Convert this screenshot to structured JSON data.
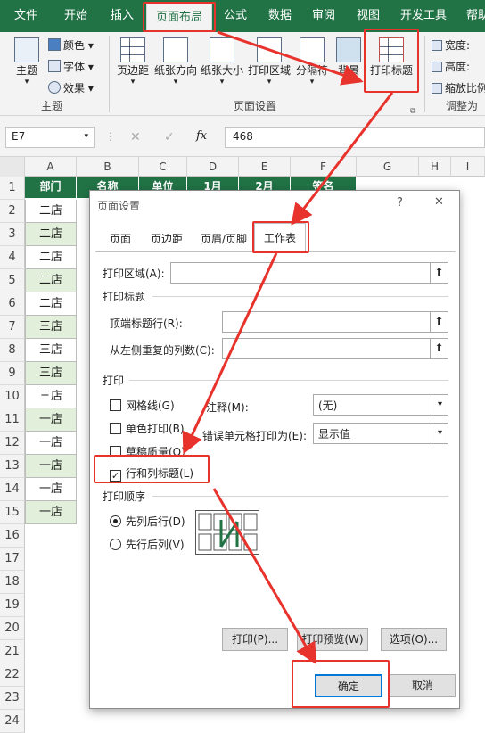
{
  "ribbon_tabs": [
    "文件",
    "开始",
    "插入",
    "页面布局",
    "公式",
    "数据",
    "审阅",
    "视图",
    "开发工具",
    "帮助"
  ],
  "ribbon": {
    "theme": {
      "main": "主题",
      "colors": "颜色",
      "fonts": "字体",
      "effects": "效果",
      "group": "主题"
    },
    "page_setup": {
      "margins": "页边距",
      "orientation": "纸张方向",
      "size": "纸张大小",
      "print_area": "打印区域",
      "breaks": "分隔符",
      "background": "背景",
      "print_titles": "打印标题",
      "group": "页面设置"
    },
    "scale": {
      "width": "宽度:",
      "height": "高度:",
      "scale": "缩放比例",
      "group": "调整为合"
    }
  },
  "formula_bar": {
    "name_box": "E7",
    "value": "468",
    "fx": "fx"
  },
  "columns": [
    "A",
    "B",
    "C",
    "D",
    "E",
    "F",
    "G",
    "H",
    "I"
  ],
  "header_row": [
    "部门",
    "名称",
    "单位",
    "1月",
    "2月",
    "签名"
  ],
  "rows": [
    {
      "n": "1",
      "a": "部门"
    },
    {
      "n": "2",
      "a": "二店"
    },
    {
      "n": "3",
      "a": "二店"
    },
    {
      "n": "4",
      "a": "二店"
    },
    {
      "n": "5",
      "a": "二店"
    },
    {
      "n": "6",
      "a": "二店"
    },
    {
      "n": "7",
      "a": "三店"
    },
    {
      "n": "8",
      "a": "三店"
    },
    {
      "n": "9",
      "a": "三店"
    },
    {
      "n": "10",
      "a": "三店"
    },
    {
      "n": "11",
      "a": "一店"
    },
    {
      "n": "12",
      "a": "一店"
    },
    {
      "n": "13",
      "a": "一店"
    },
    {
      "n": "14",
      "a": "一店"
    },
    {
      "n": "15",
      "a": "一店"
    },
    {
      "n": "16",
      "a": ""
    },
    {
      "n": "17",
      "a": ""
    },
    {
      "n": "18",
      "a": ""
    },
    {
      "n": "19",
      "a": ""
    },
    {
      "n": "20",
      "a": ""
    },
    {
      "n": "21",
      "a": ""
    },
    {
      "n": "22",
      "a": ""
    },
    {
      "n": "23",
      "a": ""
    },
    {
      "n": "24",
      "a": ""
    }
  ],
  "dialog": {
    "title": "页面设置",
    "help": "?",
    "close": "✕",
    "tabs": [
      "页面",
      "页边距",
      "页眉/页脚",
      "工作表"
    ],
    "print_area_label": "打印区域(A):",
    "print_titles_label": "打印标题",
    "top_rows_label": "顶端标题行(R):",
    "left_cols_label": "从左侧重复的列数(C):",
    "print_label": "打印",
    "gridlines": "网格线(G)",
    "bw": "单色打印(B)",
    "draft": "草稿质量(Q)",
    "row_col_headings": "行和列标题(L)",
    "comments_label": "注释(M):",
    "comments_value": "(无)",
    "errors_label": "错误单元格打印为(E):",
    "errors_value": "显示值",
    "order_label": "打印顺序",
    "down_then_over": "先列后行(D)",
    "over_then_down": "先行后列(V)",
    "btn_print": "打印(P)...",
    "btn_preview": "打印预览(W)",
    "btn_options": "选项(O)...",
    "btn_ok": "确定",
    "btn_cancel": "取消"
  },
  "colors": {
    "excel_green": "#217346",
    "annotation_red": "#e8322c"
  }
}
